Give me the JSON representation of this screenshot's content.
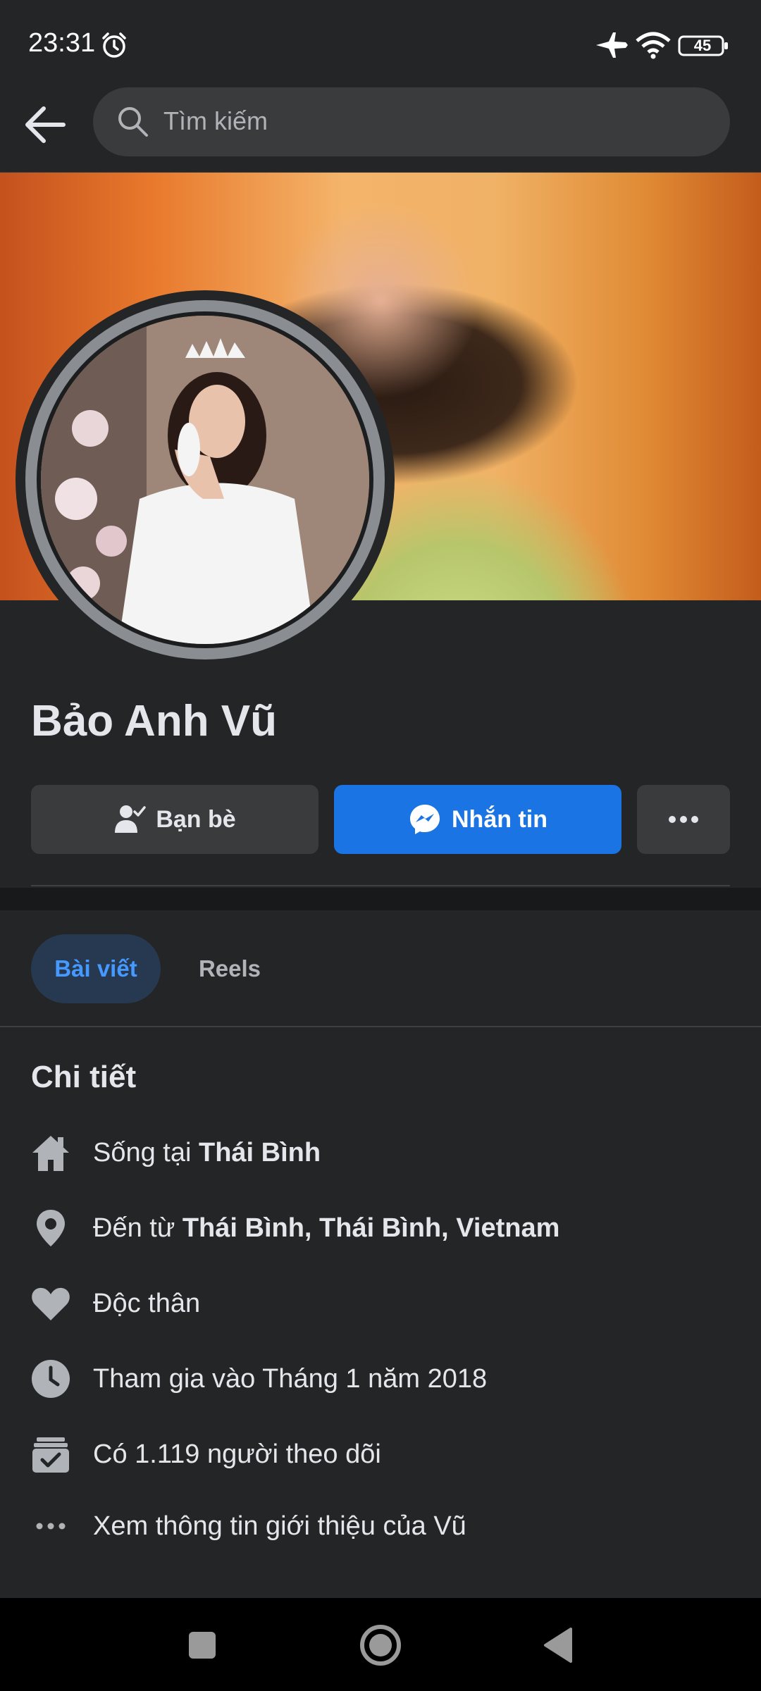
{
  "status_bar": {
    "time": "23:31",
    "battery": "45"
  },
  "search": {
    "placeholder": "Tìm kiếm"
  },
  "profile": {
    "name": "Bảo Anh Vũ"
  },
  "actions": {
    "friends_label": "Bạn bè",
    "message_label": "Nhắn tin"
  },
  "tabs": [
    {
      "label": "Bài viết"
    },
    {
      "label": "Reels"
    }
  ],
  "details": {
    "title": "Chi tiết",
    "lives_prefix": "Sống tại ",
    "lives_value": "Thái Bình",
    "from_prefix": "Đến từ ",
    "from_value": "Thái Bình, Thái Bình, Vietnam",
    "relationship": "Độc thân",
    "joined": "Tham gia vào Tháng 1 năm 2018",
    "followers": "Có 1.119 người theo dõi",
    "see_about": "Xem thông tin giới thiệu của Vũ"
  },
  "icons": {
    "back": "arrow-left-icon",
    "search": "search-icon",
    "alarm": "alarm-icon",
    "airplane": "airplane-icon",
    "wifi": "wifi-icon",
    "battery": "battery-icon",
    "friends": "person-check-icon",
    "messenger": "messenger-icon",
    "more": "ellipsis-icon",
    "home": "home-icon",
    "location": "location-pin-icon",
    "heart": "heart-icon",
    "clock": "clock-icon",
    "followers": "inbox-check-icon",
    "see_more": "ellipsis-icon"
  },
  "colors": {
    "background": "#242526",
    "accent": "#1b74e4",
    "tab_active_bg": "#263951",
    "tab_active_text": "#4599ff"
  }
}
